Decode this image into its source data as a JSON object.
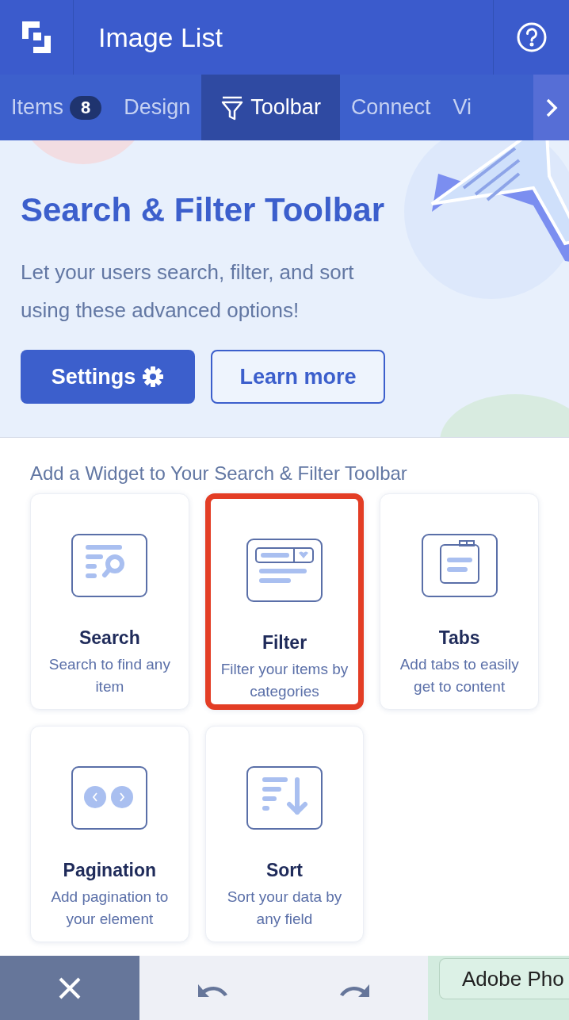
{
  "header": {
    "title": "Image List"
  },
  "tabs": [
    {
      "kind": "badge",
      "label": "Items",
      "badge": "8",
      "selected": false
    },
    {
      "kind": "plain",
      "label": "Design",
      "selected": false
    },
    {
      "kind": "icon",
      "label": "Toolbar",
      "selected": true
    },
    {
      "kind": "plain",
      "label": "Connect",
      "selected": false
    },
    {
      "kind": "plain",
      "label": "Vi",
      "selected": false
    }
  ],
  "banner": {
    "title": "Search & Filter Toolbar",
    "text": "Let your users search, filter, and sort using these advanced options!",
    "primary_button": "Settings",
    "secondary_button": "Learn more"
  },
  "section_title": "Add a Widget to Your Search & Filter Toolbar",
  "widgets": [
    {
      "kind": "search",
      "title": "Search",
      "description": "Search to find any item",
      "selected": false
    },
    {
      "kind": "filter",
      "title": "Filter",
      "description": "Filter your items by categories",
      "selected": true
    },
    {
      "kind": "tabs",
      "title": "Tabs",
      "description": "Add tabs to easily get to content",
      "selected": false
    },
    {
      "kind": "pagination",
      "title": "Pagination",
      "description": "Add pagination to your element",
      "selected": false
    },
    {
      "kind": "sort",
      "title": "Sort",
      "description": "Sort your data by any field",
      "selected": false
    }
  ],
  "bottom_bar": {
    "chip": "Adobe Pho"
  }
}
